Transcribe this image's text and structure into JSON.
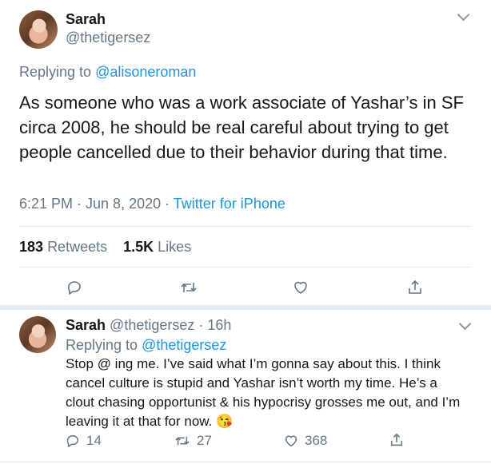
{
  "main_tweet": {
    "name": "Sarah",
    "handle": "@thetigersez",
    "replying_prefix": "Replying to",
    "replying_to": "@alisoneroman",
    "text": "As someone who was a work associate of Yashar’s in SF circa 2008, he should be real careful about trying to get people cancelled due to their behavior during that time.",
    "timestamp": "6:21 PM · Jun 8, 2020 ·",
    "source": "Twitter for iPhone",
    "retweets_count": "183",
    "retweets_label": "Retweets",
    "likes_count": "1.5K",
    "likes_label": "Likes"
  },
  "reply_tweet": {
    "name": "Sarah",
    "handle": "@thetigersez",
    "time": "· 16h",
    "replying_prefix": "Replying to",
    "replying_to": "@thetigersez",
    "text": "Stop @ ing me. I’ve said what I’m gonna say about this. I think cancel culture is stupid and Yashar isn’t worth my time. He’s a clout chasing opportunist & his hypocrisy grosses me out, and I’m leaving it at that for now. 😘",
    "reply_count": "14",
    "retweet_count": "27",
    "like_count": "368"
  },
  "colors": {
    "text": "#14171a",
    "muted": "#657786",
    "accent": "#1b95e0",
    "divider": "#e6ecf0"
  },
  "icons": [
    "chevron-down-icon",
    "reply-icon",
    "retweet-icon",
    "like-icon",
    "share-icon"
  ]
}
